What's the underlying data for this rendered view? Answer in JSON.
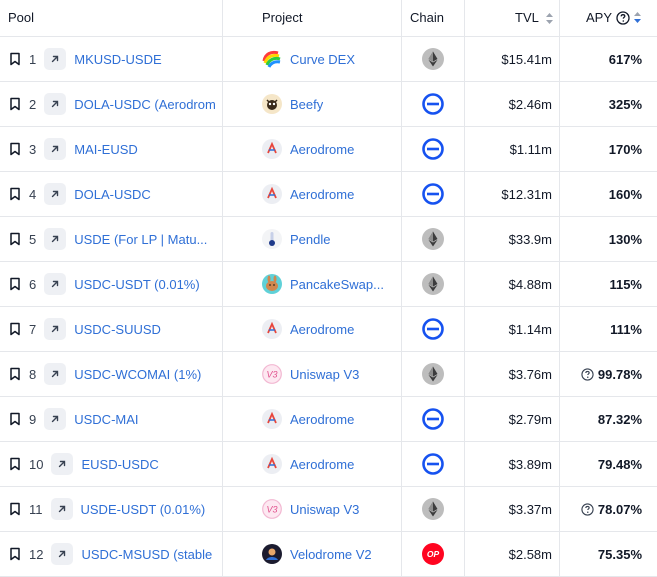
{
  "header": {
    "pool": "Pool",
    "project": "Project",
    "chain": "Chain",
    "tvl": "TVL",
    "apy": "APY"
  },
  "colors": {
    "link": "#2f6fd6",
    "base": "#1652f0",
    "ethereum_bg": "#bdbdbd",
    "optimism": "#ff0420"
  },
  "rows": [
    {
      "rank": "1",
      "pool": "MKUSD-USDE",
      "project": "Curve DEX",
      "project_icon": "curve-icon",
      "chain": "ethereum-icon",
      "tvl": "$15.41m",
      "apy": "617%",
      "apy_info": false
    },
    {
      "rank": "2",
      "pool": "DOLA-USDC (Aerodrom",
      "project": "Beefy",
      "project_icon": "beefy-icon",
      "chain": "base-icon",
      "tvl": "$2.46m",
      "apy": "325%",
      "apy_info": false
    },
    {
      "rank": "3",
      "pool": "MAI-EUSD",
      "project": "Aerodrome",
      "project_icon": "aerodrome-icon",
      "chain": "base-icon",
      "tvl": "$1.11m",
      "apy": "170%",
      "apy_info": false
    },
    {
      "rank": "4",
      "pool": "DOLA-USDC",
      "project": "Aerodrome",
      "project_icon": "aerodrome-icon",
      "chain": "base-icon",
      "tvl": "$12.31m",
      "apy": "160%",
      "apy_info": false
    },
    {
      "rank": "5",
      "pool": "USDE (For LP | Matu...",
      "project": "Pendle",
      "project_icon": "pendle-icon",
      "chain": "ethereum-icon",
      "tvl": "$33.9m",
      "apy": "130%",
      "apy_info": false
    },
    {
      "rank": "6",
      "pool": "USDC-USDT (0.01%)",
      "project": "PancakeSwap...",
      "project_icon": "pancakeswap-icon",
      "chain": "ethereum-icon",
      "tvl": "$4.88m",
      "apy": "115%",
      "apy_info": false
    },
    {
      "rank": "7",
      "pool": "USDC-SUUSD",
      "project": "Aerodrome",
      "project_icon": "aerodrome-icon",
      "chain": "base-icon",
      "tvl": "$1.14m",
      "apy": "111%",
      "apy_info": false
    },
    {
      "rank": "8",
      "pool": "USDC-WCOMAI (1%)",
      "project": "Uniswap V3",
      "project_icon": "uniswap-icon",
      "chain": "ethereum-icon",
      "tvl": "$3.76m",
      "apy": "99.78%",
      "apy_info": true
    },
    {
      "rank": "9",
      "pool": "USDC-MAI",
      "project": "Aerodrome",
      "project_icon": "aerodrome-icon",
      "chain": "base-icon",
      "tvl": "$2.79m",
      "apy": "87.32%",
      "apy_info": false
    },
    {
      "rank": "10",
      "pool": "EUSD-USDC",
      "project": "Aerodrome",
      "project_icon": "aerodrome-icon",
      "chain": "base-icon",
      "tvl": "$3.89m",
      "apy": "79.48%",
      "apy_info": false
    },
    {
      "rank": "11",
      "pool": "USDE-USDT (0.01%)",
      "project": "Uniswap V3",
      "project_icon": "uniswap-icon",
      "chain": "ethereum-icon",
      "tvl": "$3.37m",
      "apy": "78.07%",
      "apy_info": true
    },
    {
      "rank": "12",
      "pool": "USDC-MSUSD (stable",
      "project": "Velodrome V2",
      "project_icon": "velodrome-icon",
      "chain": "optimism-icon",
      "chain_label": "OP",
      "tvl": "$2.58m",
      "apy": "75.35%",
      "apy_info": false
    }
  ]
}
